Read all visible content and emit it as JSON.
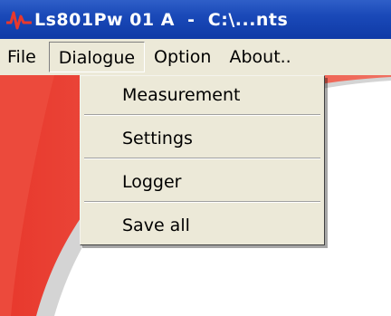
{
  "window": {
    "title": "Ls801Pw 01 A  -  C:\\...nts",
    "title_color": "#ffffff",
    "titlebar_color": "#1a49b8"
  },
  "menubar": {
    "items": [
      {
        "label": "File"
      },
      {
        "label": "Dialogue",
        "open": true
      },
      {
        "label": "Option"
      },
      {
        "label": "About.."
      }
    ]
  },
  "dropdown": {
    "items": [
      {
        "label": "Measurement"
      },
      {
        "label": "Settings"
      },
      {
        "label": "Logger"
      },
      {
        "label": "Save all"
      }
    ]
  },
  "colors": {
    "menu_bg": "#ece9d8",
    "accent_red": "#e8382c"
  },
  "icons": {
    "app": "waveform-icon"
  }
}
